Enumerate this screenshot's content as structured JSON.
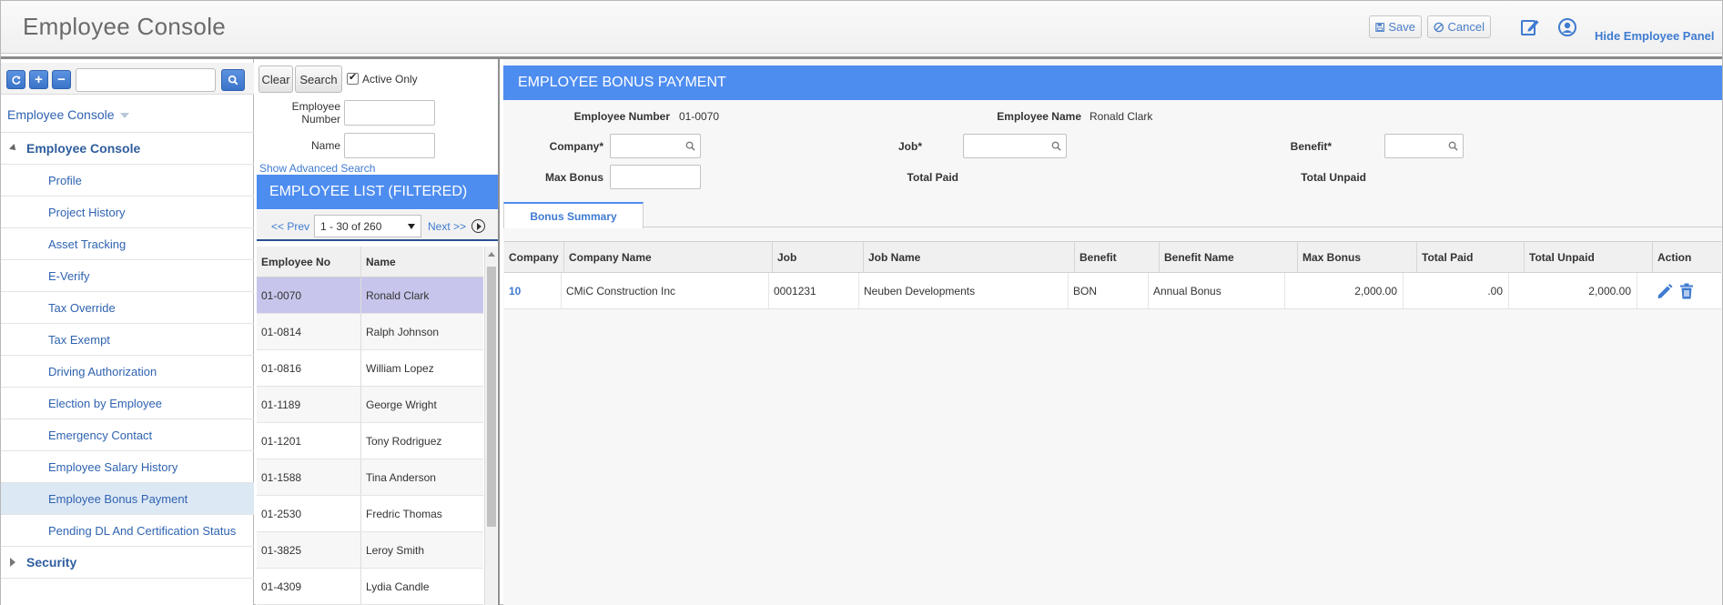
{
  "header": {
    "title": "Employee Console",
    "save_label": "Save",
    "cancel_label": "Cancel",
    "hide_panel_label": "Hide Employee Panel"
  },
  "tree": {
    "search_value": "",
    "root_label": "Employee Console",
    "group_label": "Employee Console",
    "items": [
      {
        "label": "Profile"
      },
      {
        "label": "Project History"
      },
      {
        "label": "Asset Tracking"
      },
      {
        "label": "E-Verify"
      },
      {
        "label": "Tax Override"
      },
      {
        "label": "Tax Exempt"
      },
      {
        "label": "Driving Authorization"
      },
      {
        "label": "Election by Employee"
      },
      {
        "label": "Emergency Contact"
      },
      {
        "label": "Employee Salary History"
      },
      {
        "label": "Employee Bonus Payment"
      },
      {
        "label": "Pending DL And Certification Status"
      }
    ],
    "selected_item": "Employee Bonus Payment",
    "security_label": "Security"
  },
  "employee_search": {
    "clear_label": "Clear",
    "search_label": "Search",
    "active_only_label": "Active Only",
    "active_only_checked": true,
    "employee_number_label": "Employee Number",
    "employee_number_value": "",
    "name_label": "Name",
    "name_value": "",
    "advanced_link": "Show Advanced Search"
  },
  "employee_list": {
    "title": "EMPLOYEE LIST (FILTERED)",
    "prev_label": "<< Prev",
    "page_range": "1 - 30 of 260",
    "next_label": "Next >>",
    "columns": [
      "Employee No",
      "Name"
    ],
    "rows": [
      {
        "no": "01-0070",
        "name": "Ronald Clark"
      },
      {
        "no": "01-0814",
        "name": "Ralph Johnson"
      },
      {
        "no": "01-0816",
        "name": "William Lopez"
      },
      {
        "no": "01-1189",
        "name": "George Wright"
      },
      {
        "no": "01-1201",
        "name": "Tony Rodriguez"
      },
      {
        "no": "01-1588",
        "name": "Tina Anderson"
      },
      {
        "no": "01-2530",
        "name": "Fredric Thomas"
      },
      {
        "no": "01-3825",
        "name": "Leroy Smith"
      },
      {
        "no": "01-4309",
        "name": "Lydia Candle"
      }
    ],
    "selected_row": 0
  },
  "bonus_form": {
    "title": "EMPLOYEE BONUS PAYMENT",
    "employee_number_label": "Employee Number",
    "employee_number_value": "01-0070",
    "employee_name_label": "Employee Name",
    "employee_name_value": "Ronald Clark",
    "company_label": "Company*",
    "company_value": "",
    "job_label": "Job*",
    "job_value": "",
    "benefit_label": "Benefit*",
    "benefit_value": "",
    "max_bonus_label": "Max Bonus",
    "max_bonus_value": "",
    "total_paid_label": "Total Paid",
    "total_unpaid_label": "Total Unpaid",
    "tab_label": "Bonus Summary"
  },
  "bonus_grid": {
    "columns": [
      "Company",
      "Company Name",
      "Job",
      "Job Name",
      "Benefit",
      "Benefit Name",
      "Max Bonus",
      "Total Paid",
      "Total Unpaid",
      "Action"
    ],
    "rows": [
      {
        "company": "10",
        "company_name": "CMiC Construction Inc",
        "job": "0001231",
        "job_name": "Neuben Developments",
        "benefit": "BON",
        "benefit_name": "Annual Bonus",
        "max_bonus": "2,000.00",
        "total_paid": ".00",
        "total_unpaid": "2,000.00"
      }
    ]
  },
  "colors": {
    "accent": "#4e8df0",
    "link": "#3f7bd1",
    "selected_row": "#c7c5eb",
    "selected_tree": "#dde8f5"
  }
}
